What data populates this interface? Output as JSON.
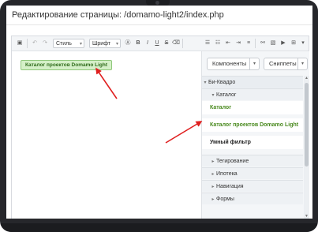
{
  "window": {
    "title": "Редактирование страницы: /domamo-light2/index.php"
  },
  "toolbar": {
    "style_select": "Стиль",
    "font_select": "Шрифт",
    "bold": "B",
    "italic": "I",
    "underline": "U",
    "strike": "S"
  },
  "editor": {
    "component_tag": "Каталог проектов Domamo Light"
  },
  "panel": {
    "tabs": [
      "Компоненты",
      "Сниппеты"
    ],
    "tree": [
      {
        "kind": "section",
        "label": "Би-Квадро",
        "expanded": true
      },
      {
        "kind": "sub",
        "label": "Каталог",
        "expanded": true
      },
      {
        "kind": "item",
        "label": "Каталог",
        "color": "#4a8a1f"
      },
      {
        "kind": "item",
        "label": "Каталог проектов Domamo Light",
        "color": "#4a8a1f"
      },
      {
        "kind": "item",
        "label": "Умный фильтр",
        "color": "#222222"
      },
      {
        "kind": "sub",
        "label": "Тегирование",
        "expanded": false
      },
      {
        "kind": "sub",
        "label": "Ипотека",
        "expanded": false
      },
      {
        "kind": "sub",
        "label": "Навигация",
        "expanded": false
      },
      {
        "kind": "sub",
        "label": "Формы",
        "expanded": false
      }
    ]
  },
  "colors": {
    "accent_green": "#4a8a1f",
    "tag_bg": "#d5f0c8",
    "arrow": "#e02020",
    "bezel": "#26272b"
  }
}
